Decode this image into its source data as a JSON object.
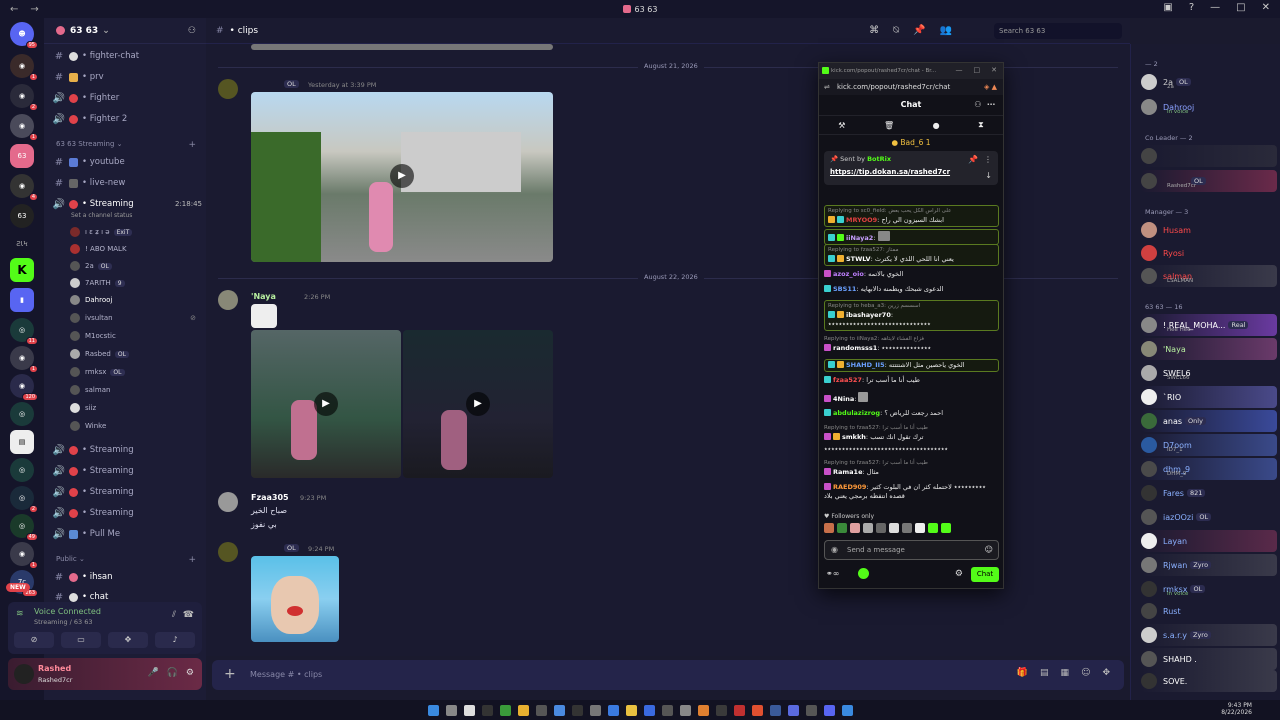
{
  "window": {
    "title": "63 63"
  },
  "guild": {
    "name": "63 63"
  },
  "channels": [
    {
      "label": "• fighter-chat",
      "icon": "text-channel"
    },
    {
      "label": "• prv",
      "icon": "lock"
    },
    {
      "label": "• Fighter",
      "icon": "voice"
    },
    {
      "label": "• Fighter 2",
      "icon": "voice"
    },
    {
      "label": "• youtube",
      "icon": "text-channel"
    },
    {
      "label": "• live-new",
      "icon": "text-channel"
    },
    {
      "label": "• Streaming",
      "icon": "voice",
      "time": "2:18:45",
      "status": "Set a channel status"
    }
  ],
  "categories": {
    "streaming": "63 63 Streaming",
    "public": "Public"
  },
  "voice_users": [
    {
      "name": "ı ɛ ʑ ı ə",
      "tag": "ExiT"
    },
    {
      "name": "! ABO MALK",
      "tag": ""
    },
    {
      "name": "2a",
      "tag": "OL"
    },
    {
      "name": "7ARITH",
      "tag": "9"
    },
    {
      "name": "Dahrooj",
      "tag": ""
    },
    {
      "name": "ivsultan",
      "tag": ""
    },
    {
      "name": "M1ocstic",
      "tag": ""
    },
    {
      "name": "Rasbed",
      "tag": "OL"
    },
    {
      "name": "rmksx",
      "tag": "OL"
    },
    {
      "name": "salman",
      "tag": ""
    },
    {
      "name": "siiz",
      "tag": ""
    },
    {
      "name": "Winke",
      "tag": ""
    }
  ],
  "channels2": [
    {
      "label": "• Streaming"
    },
    {
      "label": "• Streaming"
    },
    {
      "label": "• Streaming"
    },
    {
      "label": "• Streaming"
    },
    {
      "label": "• Pull Me"
    }
  ],
  "public_channels": [
    {
      "label": "• ihsan"
    },
    {
      "label": "• chat"
    }
  ],
  "voice": {
    "status": "Voice Connected",
    "channel": "Streaming / 63 63",
    "new_badge": "NEW"
  },
  "user": {
    "name": "Rashed",
    "sub": "Rashed7cr"
  },
  "header": {
    "channel": "• clips",
    "search_placeholder": "Search 63 63"
  },
  "dates": [
    "August 21, 2026",
    "August 22, 2026"
  ],
  "messages": [
    {
      "name": "",
      "tag": "OL",
      "time": "Yesterday at 3:39 PM"
    },
    {
      "name": "'Naya",
      "time": "2:26 PM"
    },
    {
      "name": "Fzaa305",
      "time": "9:23 PM",
      "lines": [
        "صباح الخير",
        "بي نفوز"
      ]
    },
    {
      "name": "",
      "tag": "OL",
      "time": "9:24 PM"
    }
  ],
  "composer": {
    "placeholder": "Message # • clips"
  },
  "popout": {
    "tab_title": "kick.com/popout/rashed7cr/chat - Br...",
    "url": "kick.com/popout/rashed7cr/chat",
    "title": "Chat",
    "pinned": "Bad_6 1",
    "sent_by": "BotRix",
    "sent_by_prefix": "Sent by",
    "link": "https://tip.dokan.sa/rashed7cr",
    "chat": [
      {
        "reply": "Replying to sc0_field: على الراس الكل يحب بعض",
        "user": "MRYOO9",
        "text": "ابشك السيزون الي راح",
        "hl": true
      },
      {
        "reply": "",
        "user": "iiNaya2",
        "text": "",
        "hl": true
      },
      {
        "reply": "Replying to fzaa527: ممتاز",
        "user": "STWLV",
        "text": "يعني انا اللحي اللذي لا يكترث",
        "hl": true
      },
      {
        "reply": "",
        "user": "azoz_oio",
        "text": "الخوي بالاتمه"
      },
      {
        "reply": "",
        "user": "SBS11",
        "text": "الدعوى شبحك ويطمنه دالابهايه"
      },
      {
        "reply": "Replying to heba_a3: اسسسم زرين",
        "user": "ibashayer70",
        "text": "٭٭٭٭٭٭٭٭٭٭٭٭٭٭٭٭٭٭٭٭٭٭٭٭٭٭٭٭٭",
        "hl": true
      },
      {
        "reply": "Replying to iiNaya2: فزاع الفشاء لايتاهه",
        "user": "randomsss1",
        "text": "٭٭٭٭٭٭٭٭٭٭٭٭٭٭"
      },
      {
        "reply": "",
        "user": "SHAHD_II5",
        "text": "الخوي ياحصين مثل الاشتتتته",
        "hl": true
      },
      {
        "reply": "",
        "user": "fzaa527",
        "text": "طيب أنا ما أسب ترا"
      },
      {
        "reply": "",
        "user": "4Nina",
        "text": ""
      },
      {
        "reply": "",
        "user": "abdulazizrog",
        "text": "احمد رجعت للرياض ؟"
      },
      {
        "reply": "Replying to fzaa527: طيب أنا ما أسب ترا",
        "user": "smkkh",
        "text": "ترك تقول انك تسب"
      },
      {
        "reply": "",
        "user": "",
        "text": "٭٭٭٭٭٭٭٭٭٭٭٭٭٭٭٭٭٭٭٭٭٭٭٭٭٭٭٭٭٭٭٭٭٭٭"
      },
      {
        "reply": "Replying to fzaa527: طيب أنا ما أسب ترا",
        "user": "Rama1e",
        "text": "مثال"
      },
      {
        "reply": "",
        "user": "RAED909",
        "text": "٭٭٭٭٭٭٭٭٭ لاحتمله كثر ان في البلوت كثير قصده انتفظه برمجي يعني بلاد"
      }
    ],
    "followers_only": "Followers only",
    "send_placeholder": "Send a message",
    "chat_button": "Chat"
  },
  "members": {
    "groups": [
      {
        "label": "— 2",
        "items": [
          {
            "name": "2a",
            "tag": "OL",
            "sub": "2a"
          },
          {
            "name": "Dahrooj",
            "sub": "In voice"
          }
        ]
      },
      {
        "label": "Co Leader — 2",
        "items": [
          {
            "name": "",
            "sub": ""
          },
          {
            "name": "",
            "tag": "OL",
            "sub": "Rashed7cr"
          }
        ]
      },
      {
        "label": "Manager — 3",
        "items": [
          {
            "name": "Husam",
            "sub": ""
          },
          {
            "name": "Ryosi",
            "sub": ""
          },
          {
            "name": "salman",
            "sub": "LSALMAN"
          }
        ]
      },
      {
        "label": "63 63 — 16",
        "items": [
          {
            "name": "! REAL_MOHA...",
            "tag": "Real",
            "sub": "Hee Hee"
          },
          {
            "name": "'Naya",
            "sub": ""
          },
          {
            "name": "SWEL6",
            "sub": "SWEL66"
          },
          {
            "name": "`RIO",
            "sub": ""
          },
          {
            "name": "anas",
            "tag": "Only",
            "sub": ""
          },
          {
            "name": "D7oom",
            "sub": "ID7_1"
          },
          {
            "name": "dhm_9",
            "sub": "DHM_9"
          },
          {
            "name": "Fares",
            "tag": "821",
            "sub": ""
          },
          {
            "name": "iazOOzi",
            "tag": "OL",
            "sub": ""
          },
          {
            "name": "Layan",
            "sub": ""
          },
          {
            "name": "Rjwan",
            "tag": "Zyro",
            "sub": ""
          },
          {
            "name": "rmksx",
            "tag": "OL",
            "sub": "In voice"
          },
          {
            "name": "Rust",
            "sub": ""
          },
          {
            "name": "s.a.r.y",
            "tag": "Zyro",
            "sub": ""
          },
          {
            "name": "SHAHD .",
            "sub": ""
          },
          {
            "name": "SOVE.",
            "sub": ""
          }
        ]
      }
    ]
  },
  "tray": {
    "time": "9:43 PM",
    "date": "8/22/2026"
  }
}
